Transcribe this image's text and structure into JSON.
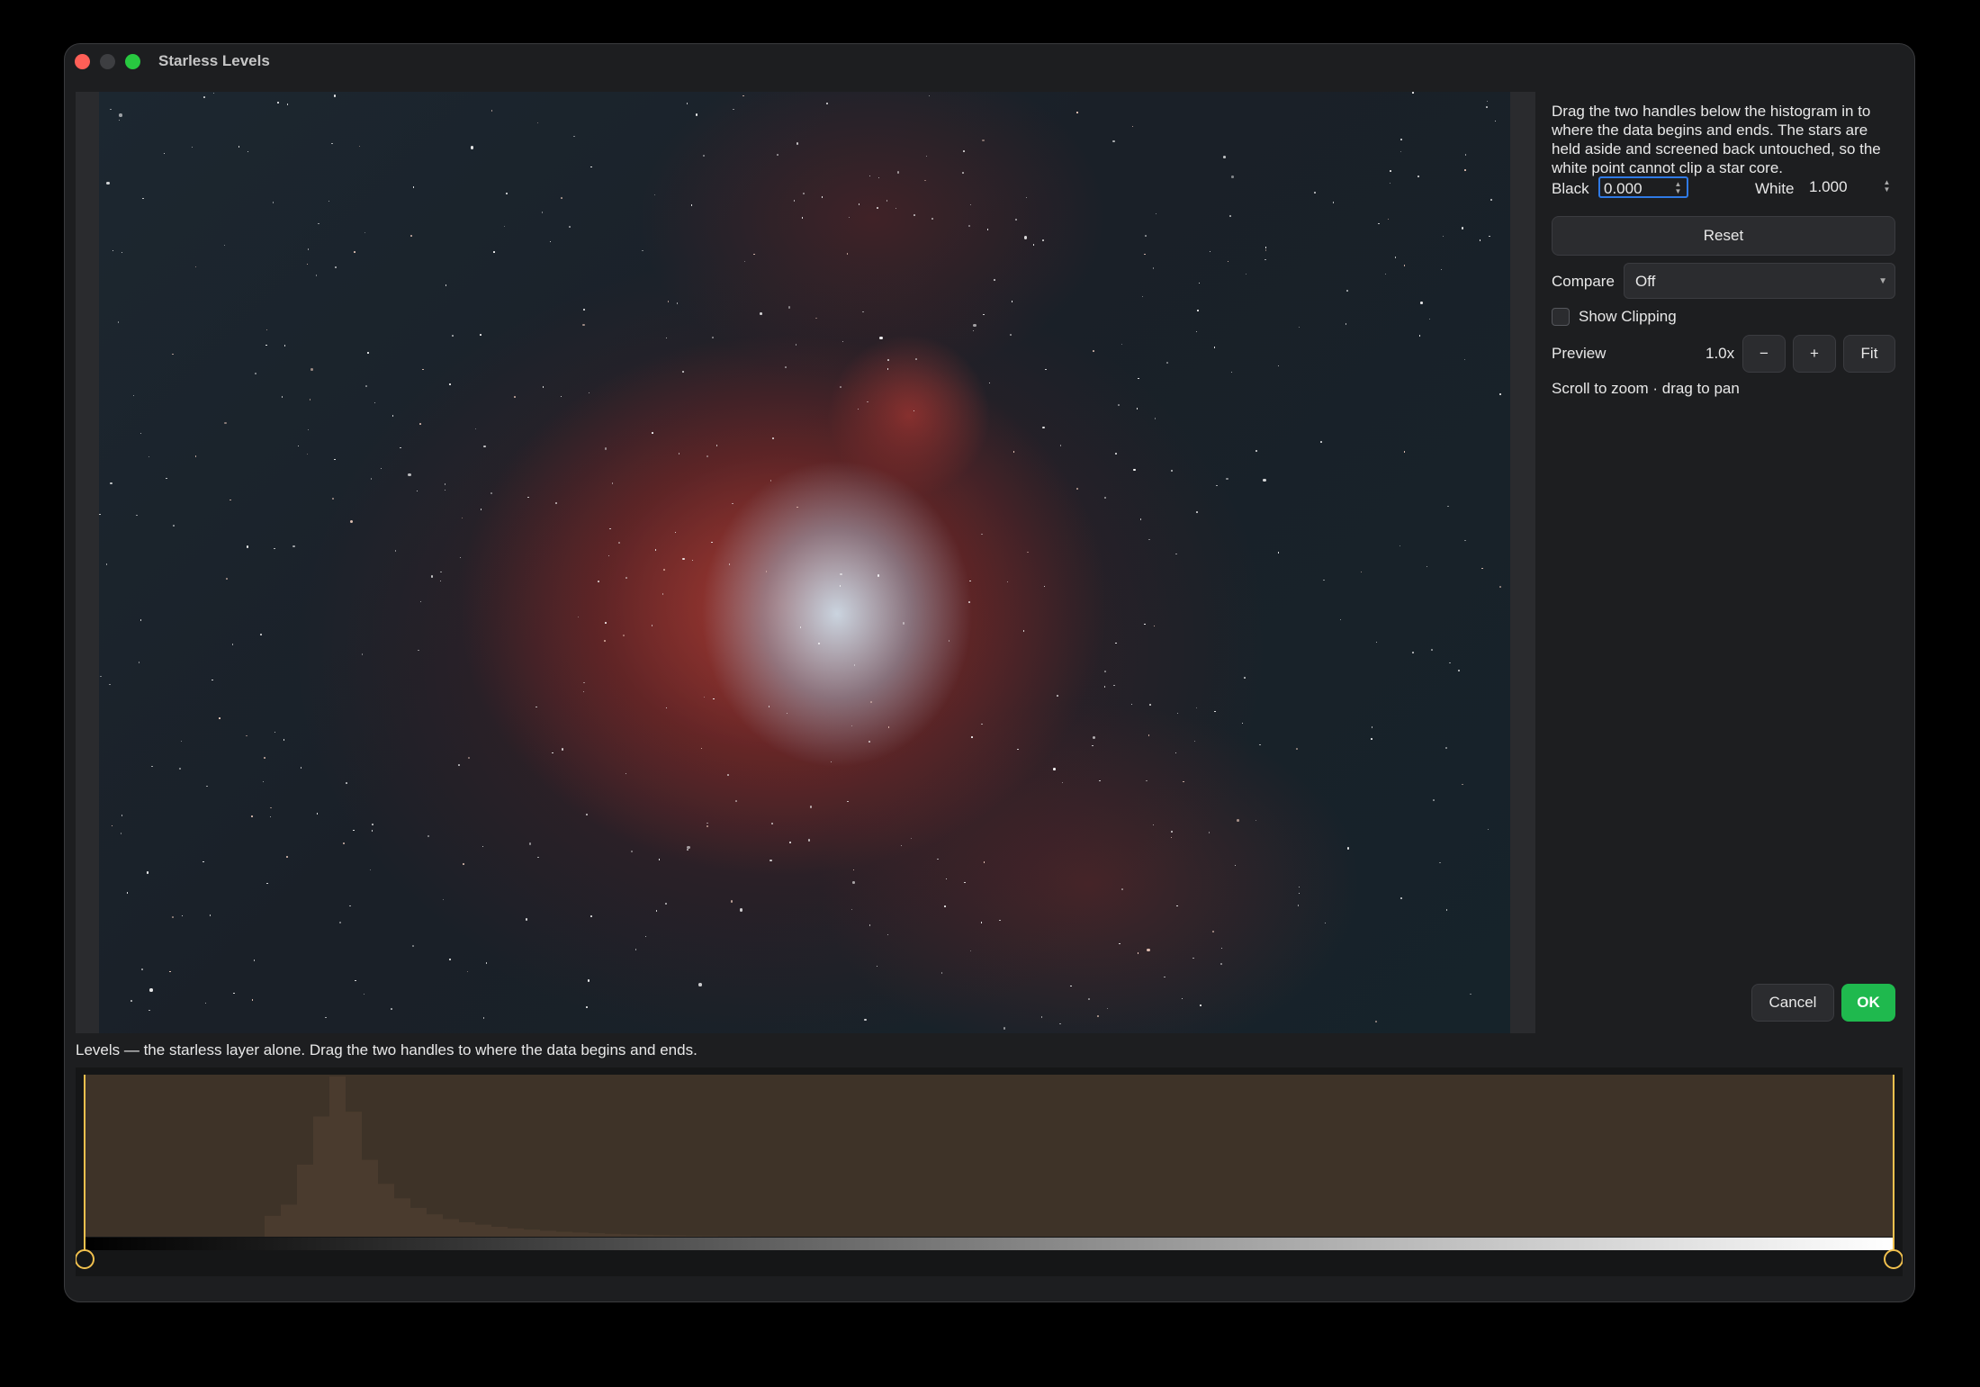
{
  "window": {
    "title": "Starless Levels"
  },
  "side": {
    "help_text": "Drag the two handles below the histogram in to where the data begins and ends. The stars are held aside and screened back untouched, so the white point cannot clip a star core.",
    "black_label": "Black",
    "black_value": "0.000",
    "white_label": "White",
    "white_value": "1.000",
    "reset_label": "Reset",
    "compare_label": "Compare",
    "compare_value": "Off",
    "show_clipping_label": "Show Clipping",
    "show_clipping_checked": false,
    "preview_label": "Preview",
    "zoom_value": "1.0x",
    "zoom_out_label": "−",
    "zoom_in_label": "+",
    "fit_label": "Fit",
    "hint": "Scroll to zoom · drag to pan",
    "cancel_label": "Cancel",
    "ok_label": "OK"
  },
  "histogram": {
    "caption": "Levels — the starless layer alone. Drag the two handles to where the data begins and ends.",
    "black_point": 0.0,
    "white_point": 1.0,
    "bins": [
      0.13,
      0.2,
      0.45,
      0.75,
      1.0,
      0.78,
      0.48,
      0.33,
      0.24,
      0.18,
      0.14,
      0.11,
      0.09,
      0.075,
      0.062,
      0.052,
      0.044,
      0.037,
      0.031,
      0.026,
      0.022,
      0.018,
      0.015,
      0.012,
      0.01,
      0.008,
      0.006,
      0.005,
      0.004,
      0.003
    ],
    "colors": {
      "fill": "#3e3328",
      "peak": "#4a3b2e",
      "handle": "#f2c14e"
    }
  }
}
